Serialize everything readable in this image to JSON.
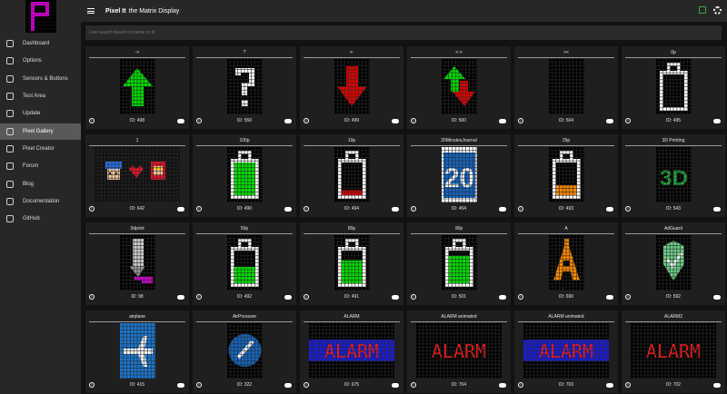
{
  "app": {
    "title": "Pixel It",
    "subtitle": "the Matrix Display"
  },
  "sidebar": {
    "items": [
      {
        "label": "Dashboard",
        "icon": "dashboard-icon"
      },
      {
        "label": "Options",
        "icon": "cog-icon"
      },
      {
        "label": "Sensors & Buttons",
        "icon": "sensor-icon"
      },
      {
        "label": "Test Area",
        "icon": "flask-icon"
      },
      {
        "label": "Update",
        "icon": "upload-icon"
      },
      {
        "label": "Pixel Gallery",
        "icon": "gallery-icon",
        "active": true
      },
      {
        "label": "Pixel Creator",
        "icon": "pencil-icon"
      },
      {
        "label": "Forum",
        "icon": "forum-icon"
      },
      {
        "label": "Blog",
        "icon": "blog-icon"
      },
      {
        "label": "Documentation",
        "icon": "book-icon"
      },
      {
        "label": "GitHub",
        "icon": "github-icon"
      }
    ]
  },
  "search": {
    "placeholder": "Live search based on name or id"
  },
  "gallery": [
    {
      "title": "->",
      "id": "ID: 498",
      "art": "arrow-up-green"
    },
    {
      "title": "?",
      "id": "ID: 550",
      "art": "question-mark"
    },
    {
      "title": "<-",
      "id": "ID: 499",
      "art": "arrow-down-red"
    },
    {
      "title": "<->",
      "id": "ID: 500",
      "art": "arrows-green-red"
    },
    {
      "title": "><",
      "id": "ID: 504",
      "art": "black"
    },
    {
      "title": "0p",
      "id": "ID: 495",
      "art": "battery-0"
    },
    {
      "title": "1",
      "id": "ID: 642",
      "art": "characters"
    },
    {
      "title": "100p",
      "id": "ID: 490",
      "art": "battery-100"
    },
    {
      "title": "10p",
      "id": "ID: 494",
      "art": "battery-10"
    },
    {
      "title": "20MinutesJournal",
      "id": "ID: 454",
      "art": "twenty-logo"
    },
    {
      "title": "25p",
      "id": "ID: 493",
      "art": "battery-25"
    },
    {
      "title": "3D Printing",
      "id": "ID: 543",
      "art": "3d-logo"
    },
    {
      "title": "3dprint",
      "id": "ID: 98",
      "art": "printer-nozzle"
    },
    {
      "title": "50p",
      "id": "ID: 492",
      "art": "battery-50"
    },
    {
      "title": "80p",
      "id": "ID: 491",
      "art": "battery-80"
    },
    {
      "title": "90p",
      "id": "ID: 501",
      "art": "battery-90"
    },
    {
      "title": "A",
      "id": "ID: 690",
      "art": "letter-a"
    },
    {
      "title": "AdGuard",
      "id": "ID: 592",
      "art": "shield"
    },
    {
      "title": "airplane",
      "id": "ID: 415",
      "art": "airplane"
    },
    {
      "title": "AirPressure",
      "id": "ID: 322",
      "art": "gauge"
    },
    {
      "title": "ALARM",
      "id": "ID: 675",
      "art": "alarm-blue"
    },
    {
      "title": "ALARM animated",
      "id": "ID: 704",
      "art": "alarm-red"
    },
    {
      "title": "ALARM animated",
      "id": "ID: 703",
      "art": "alarm-blue"
    },
    {
      "title": "ALARM2",
      "id": "ID: 702",
      "art": "alarm-red"
    }
  ],
  "pixel_art_text": {
    "twenty": "20",
    "threed": "3D",
    "alarm": "ALARM"
  },
  "colors": {
    "sidebar_bg": "#272727",
    "active_item": "#595959",
    "accent_green": "#3aa24a",
    "pixel_green": "#00e000",
    "pixel_red": "#e00000",
    "pixel_blue": "#1565c0",
    "pixel_orange": "#ff8a00",
    "logo_magenta": "#d100d1"
  }
}
